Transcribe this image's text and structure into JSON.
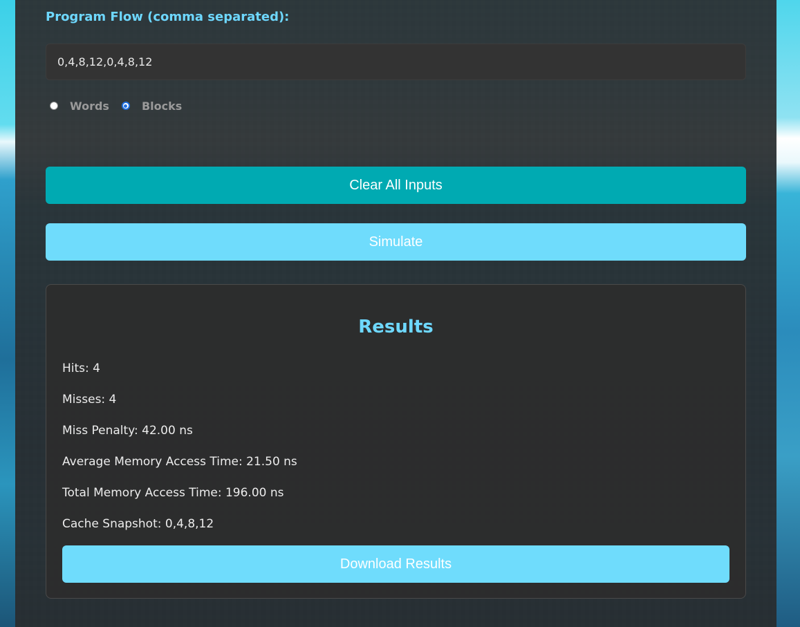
{
  "form": {
    "program_flow_label": "Program Flow (comma separated):",
    "program_flow_value": "0,4,8,12,0,4,8,12",
    "unit_options": [
      {
        "label": "Words",
        "selected": false
      },
      {
        "label": "Blocks",
        "selected": true
      }
    ]
  },
  "buttons": {
    "clear_label": "Clear All Inputs",
    "simulate_label": "Simulate",
    "download_label": "Download Results"
  },
  "results": {
    "title": "Results",
    "hits": "Hits: 4",
    "misses": "Misses: 4",
    "miss_penalty": "Miss Penalty: 42.00 ns",
    "average_access_time": "Average Memory Access Time: 21.50 ns",
    "total_access_time": "Total Memory Access Time: 196.00 ns",
    "cache_snapshot": "Cache Snapshot: 0,4,8,12"
  },
  "colors": {
    "accent": "#6ed8ff",
    "clear_button": "#00aab2",
    "primary_button": "#6fdcfc",
    "panel_bg": "#2c2f31",
    "radio_selected": "#1f6fe0"
  }
}
